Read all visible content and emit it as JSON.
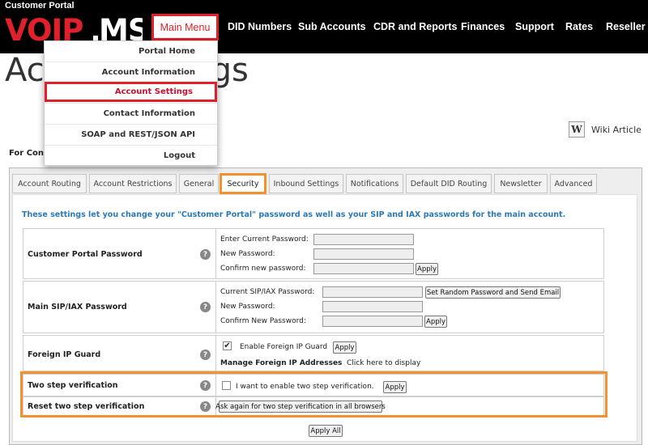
{
  "header": {
    "portal_label": "Customer Portal",
    "logo_text": "VOIP.MS",
    "main_menu": "Main Menu",
    "nav_items": [
      "DID Numbers",
      "Sub Accounts",
      "CDR and Reports",
      "Finances",
      "Support",
      "Rates",
      "Reseller"
    ]
  },
  "dropdown": {
    "items": [
      "Portal Home",
      "Account Information",
      "Account Settings",
      "Contact Information",
      "SOAP and REST/JSON API",
      "Logout"
    ],
    "active": "Account Settings"
  },
  "page": {
    "title_visible_left": "Acc",
    "title_visible_right": "gs",
    "wiki_label": "Wiki Article",
    "wiki_icon": "W",
    "for_conn": "For Conn"
  },
  "tabs": {
    "items": [
      "Account Routing",
      "Account Restrictions",
      "General",
      "Security",
      "Inbound Settings",
      "Notifications",
      "Default DID Routing",
      "Newsletter",
      "Advanced"
    ],
    "active": "Security"
  },
  "security": {
    "intro": "These settings let you change your \"Customer Portal\" password as well as your SIP and IAX passwords for the main account.",
    "portal_password": {
      "label": "Customer Portal Password",
      "current_label": "Enter Current Password:",
      "new_label": "New Password:",
      "confirm_label": "Confirm new password:",
      "apply": "Apply"
    },
    "sip_password": {
      "label": "Main SIP/IAX Password",
      "current_label": "Current SIP/IAX Password:",
      "random_button": "Set Random Password and Send Email",
      "new_label": "New Password:",
      "confirm_label": "Confirm New Password:",
      "apply": "Apply"
    },
    "foreign_ip": {
      "label": "Foreign IP Guard",
      "checkbox_label": "Enable Foreign IP Guard",
      "checked": true,
      "apply": "Apply",
      "manage_label": "Manage Foreign IP Addresses",
      "manage_link": "Click here to display"
    },
    "two_step": {
      "label": "Two step verification",
      "checkbox_label": "I want to enable two step verification.",
      "checked": false,
      "apply": "Apply"
    },
    "reset_two_step": {
      "label": "Reset two step verification",
      "button": "Ask again for two step verification in all browsers"
    },
    "apply_all": "Apply All",
    "help_glyph": "?"
  },
  "colors": {
    "nav_bg": "#000000",
    "accent_red": "#e0202a",
    "accent_orange": "#f39030",
    "intro_blue": "#2a7ab8"
  }
}
